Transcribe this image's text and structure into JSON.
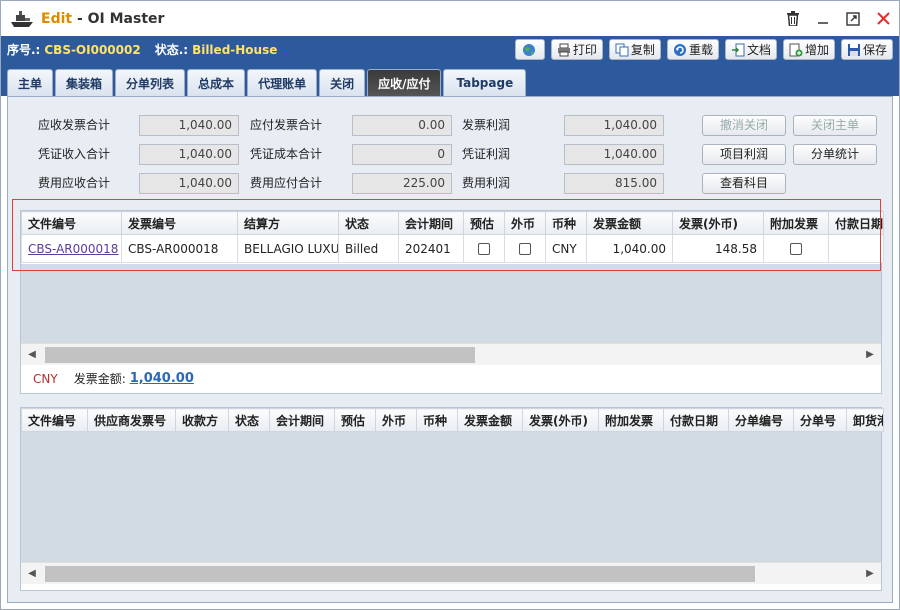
{
  "window": {
    "mode": "Edit",
    "separator": " - ",
    "title": "OI Master",
    "icon": "ship-icon",
    "controls": [
      "trash-icon",
      "minimize-icon",
      "maximize-icon",
      "close-icon"
    ]
  },
  "info": {
    "serial_label": "序号.:",
    "serial_value": "CBS-OI000002",
    "status_label": "状态.:",
    "status_value": "Billed-House"
  },
  "toolbar": {
    "print": "打印",
    "copy": "复制",
    "reload": "重载",
    "docs": "文档",
    "add": "增加",
    "save": "保存"
  },
  "tabs": [
    "主单",
    "集装箱",
    "分单列表",
    "总成本",
    "代理账单",
    "关闭",
    "应收/应付",
    "Tabpage"
  ],
  "active_tab": "应收/应付",
  "summary": {
    "ar_invoice_total": {
      "label": "应收发票合计",
      "value": "1,040.00"
    },
    "voucher_income_total": {
      "label": "凭证收入合计",
      "value": "1,040.00"
    },
    "fee_ar_total": {
      "label": "费用应收合计",
      "value": "1,040.00"
    },
    "ap_invoice_total": {
      "label": "应付发票合计",
      "value": "0.00"
    },
    "voucher_cost_total": {
      "label": "凭证成本合计",
      "value": "0"
    },
    "fee_ap_total": {
      "label": "费用应付合计",
      "value": "225.00"
    },
    "invoice_profit": {
      "label": "发票利润",
      "value": "1,040.00"
    },
    "voucher_profit": {
      "label": "凭证利润",
      "value": "1,040.00"
    },
    "fee_profit": {
      "label": "费用利润",
      "value": "815.00"
    },
    "buttons": {
      "cancel_close": "撤消关闭",
      "close_master": "关闭主单",
      "project_profit": "项目利润",
      "house_stats": "分单统计",
      "view_accounts": "查看科目"
    }
  },
  "ar_grid": {
    "columns": [
      "文件编号",
      "发票编号",
      "结算方",
      "状态",
      "会计期间",
      "预估",
      "外币",
      "币种",
      "发票金额",
      "发票(外币)",
      "附加发票",
      "付款日期"
    ],
    "rows": [
      {
        "file_no": "CBS-AR000018",
        "invoice_no": "CBS-AR000018",
        "settle_party": "BELLAGIO LUXURY",
        "status": "Billed",
        "period": "202401",
        "estimated": false,
        "foreign": false,
        "currency": "CNY",
        "amount": "1,040.00",
        "amount_fc": "148.58",
        "extra_invoice": false,
        "pay_date": ""
      }
    ],
    "footer": {
      "currency": "CNY",
      "amount_label": "发票金额:",
      "amount_value": "1,040.00"
    }
  },
  "ap_grid": {
    "columns": [
      "文件编号",
      "供应商发票号",
      "收款方",
      "状态",
      "会计期间",
      "预估",
      "外币",
      "币种",
      "发票金额",
      "发票(外币)",
      "附加发票",
      "付款日期",
      "分单编号",
      "分单号",
      "卸货港"
    ]
  },
  "colors": {
    "header_blue": "#2d5a9c",
    "status_yellow": "#ffe26a",
    "edit_orange": "#e08a00",
    "highlight_red": "#e53c3c"
  }
}
